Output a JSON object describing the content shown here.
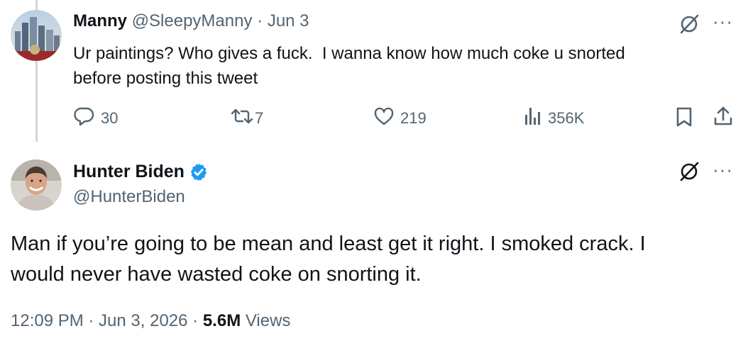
{
  "reply": {
    "display_name": "Manny",
    "handle": "@SleepyManny",
    "separator": "·",
    "date": "Jun 3",
    "text_line1": "Ur paintings? Who gives a fuck.  I wanna know how much coke u snorted",
    "text_line2": "before posting this tweet",
    "stats": {
      "replies": "30",
      "reposts": "7",
      "likes": "219",
      "views": "356K"
    },
    "icons": [
      "grok-icon",
      "more-icon",
      "reply-icon",
      "repost-icon",
      "like-icon",
      "views-icon",
      "bookmark-icon",
      "share-icon"
    ]
  },
  "main": {
    "display_name": "Hunter Biden",
    "handle": "@HunterBiden",
    "verified": true,
    "text_line1": "Man if you’re going to be mean and least get it right. I smoked crack. I",
    "text_line2": "would never have wasted coke on snorting it.",
    "timestamp": "12:09 PM · Jun 3, 2026 ·",
    "views_count": "5.6M",
    "views_label": "Views"
  },
  "colors": {
    "verified_blue": "#1d9bf0",
    "muted_gray": "#536471",
    "thread_line": "#cfd9de"
  }
}
